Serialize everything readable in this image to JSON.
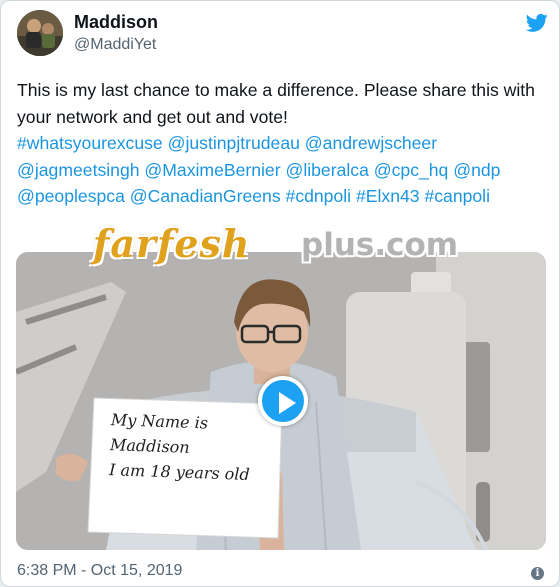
{
  "author": {
    "display_name": "Maddison",
    "handle": "@MaddiYet"
  },
  "tweet": {
    "line_intro": "This is my last chance to make a difference. Please share this with your network and get out and vote!",
    "tags": [
      "#whatsyourexcuse",
      "@justinpjtrudeau",
      "@andrewjscheer",
      "@jagmeetsingh",
      "@MaximeBernier",
      "@liberalca",
      "@cpc_hq",
      "@ndp",
      "@peoplespca",
      "@CanadianGreens",
      "#cdnpoli",
      "#Elxn43",
      "#canpoli"
    ],
    "timestamp": "6:38 PM - Oct 15, 2019"
  },
  "media": {
    "sign_lines": [
      "My Name is",
      "Maddison",
      "I am 18 years old"
    ]
  },
  "watermark": {
    "main": "farfesh",
    "tail": "plus.com"
  },
  "icons": {
    "brand": "twitter-bird-icon",
    "play": "play-icon",
    "info": "info-icon"
  },
  "colors": {
    "link": "#1b95e0",
    "brand": "#1da1f2",
    "muted": "#536471",
    "watermark": "#e0a11d"
  }
}
